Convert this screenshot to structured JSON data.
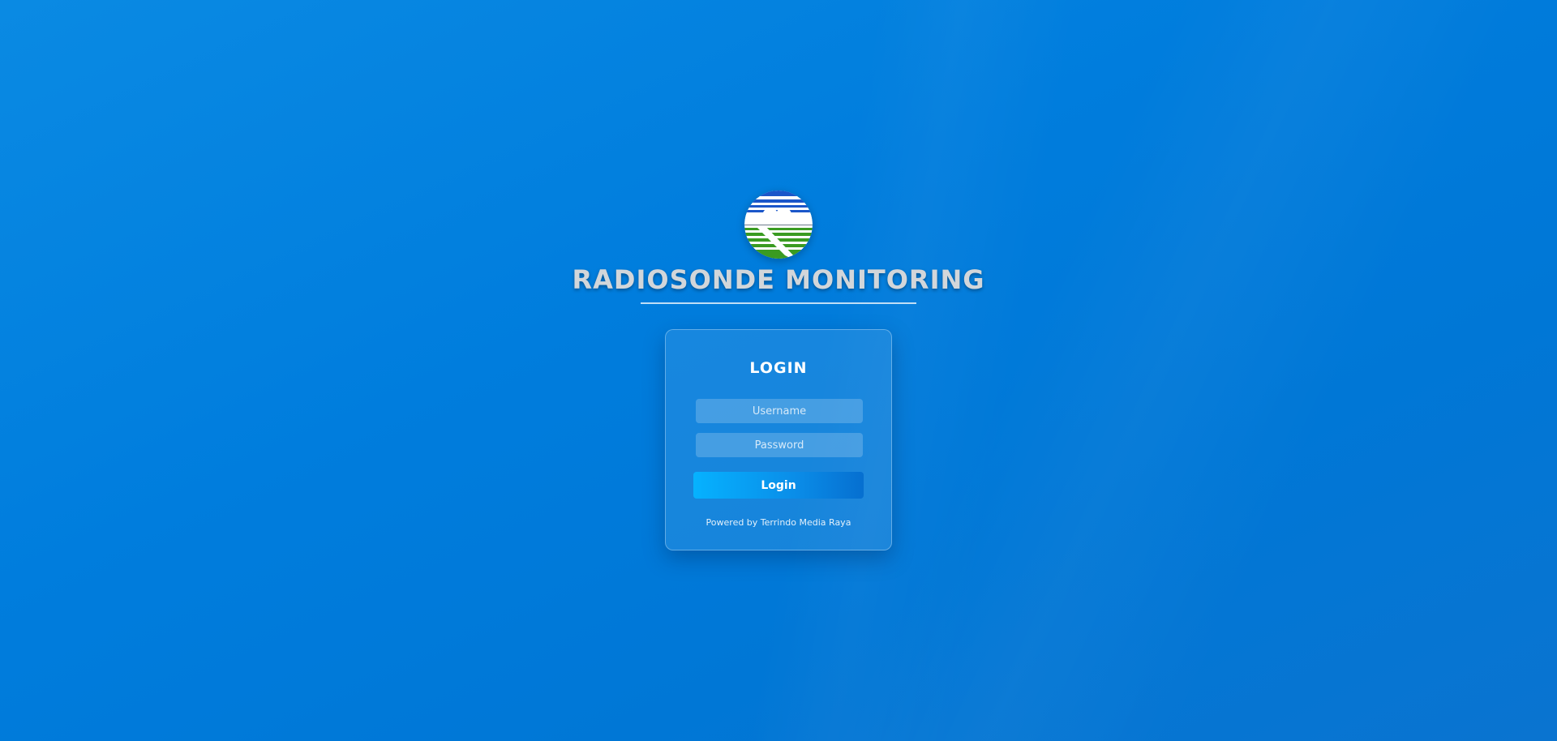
{
  "app": {
    "title": "RADIOSONDE MONITORING",
    "logo_icon": "bmkg-weather-logo-icon"
  },
  "login": {
    "heading": "LOGIN",
    "username_placeholder": "Username",
    "password_placeholder": "Password",
    "button_label": "Login",
    "footer": "Powered by Terrindo Media Raya"
  },
  "colors": {
    "background": "#007ddd",
    "button_start": "#06b2ff",
    "button_end": "#066fd0",
    "logo_blue": "#1b56c9",
    "logo_green": "#3a9b21"
  }
}
